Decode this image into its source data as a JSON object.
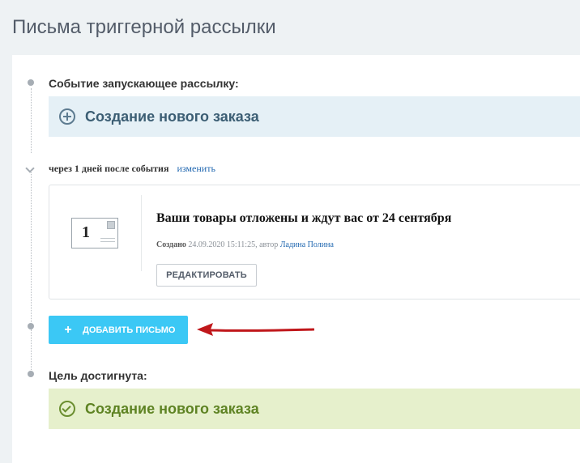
{
  "page": {
    "title": "Письма триггерной рассылки"
  },
  "trigger": {
    "label": "Событие запускающее рассылку:",
    "event_title": "Создание нового заказа",
    "icon": "plus-circle-icon"
  },
  "delay": {
    "text": "через 1 дней после события",
    "change_link": "изменить"
  },
  "letter": {
    "number": "1",
    "title": "Ваши товары отложены и ждут вас от 24 сентября",
    "created_label": "Создано",
    "created_at": "24.09.2020 15:11:25, автор",
    "author": "Ладина Полина",
    "edit_label": "РЕДАКТИРОВАТЬ"
  },
  "add_letter": {
    "plus": "+",
    "label": "ДОБАВИТЬ ПИСЬМО"
  },
  "goal": {
    "label": "Цель достигнута:",
    "event_title": "Создание нового заказа",
    "icon": "check-circle-icon"
  },
  "colors": {
    "accent_button": "#3bc8f5",
    "trigger_bg": "#e5f0f6",
    "goal_bg": "#e6f0cc",
    "arrow": "#c0171b",
    "link": "#2067b0"
  }
}
